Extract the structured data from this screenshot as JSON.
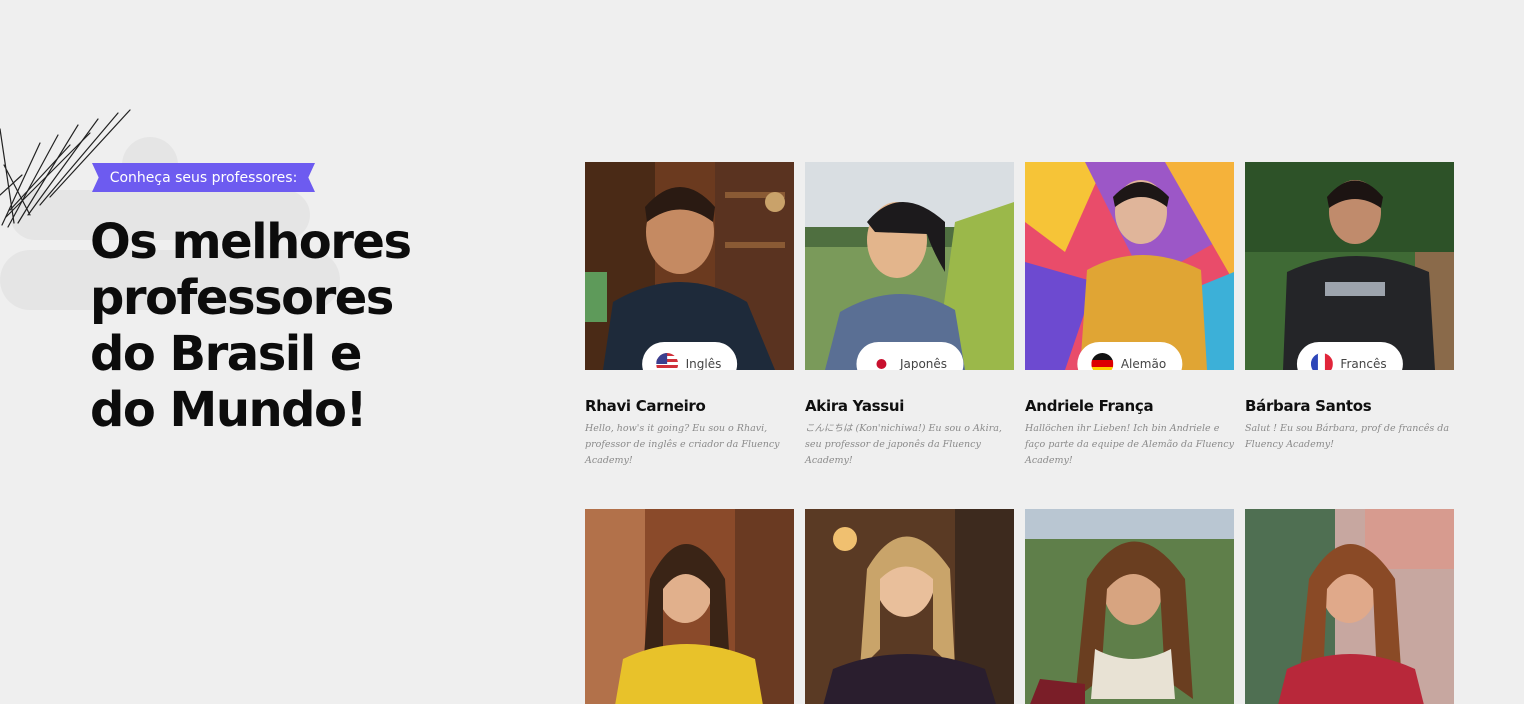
{
  "intro": {
    "tag_label": "Conheça seus professores:",
    "headline_lines": [
      "Os melhores",
      "professores",
      "do Brasil e",
      "do Mundo!"
    ]
  },
  "teachers": [
    {
      "name": "Rhavi Carneiro",
      "language": "Inglês",
      "flag": "us-flag-icon",
      "bio": "Hello, how's it going? Eu sou o Rhavi, professor de inglês e criador da Fluency Academy!"
    },
    {
      "name": "Akira Yassui",
      "language": "Japonês",
      "flag": "japan-flag-icon",
      "bio": "こんにちは (Kon'nichiwa!) Eu sou o Akira, seu professor de japonês da Fluency Academy!"
    },
    {
      "name": "Andriele França",
      "language": "Alemão",
      "flag": "germany-flag-icon",
      "bio": "Hallöchen ihr Lieben! Ich bin Andriele e faço parte da equipe de Alemão da Fluency Academy!"
    },
    {
      "name": "Bárbara Santos",
      "language": "Francês",
      "flag": "france-flag-icon",
      "bio": "Salut ! Eu sou Bárbara, prof de francês da Fluency Academy!"
    }
  ],
  "colors": {
    "background": "#efefef",
    "tag_accent": "#6d5bf0",
    "headline": "#0c0c0c",
    "bio_text": "#8a8a8a"
  }
}
